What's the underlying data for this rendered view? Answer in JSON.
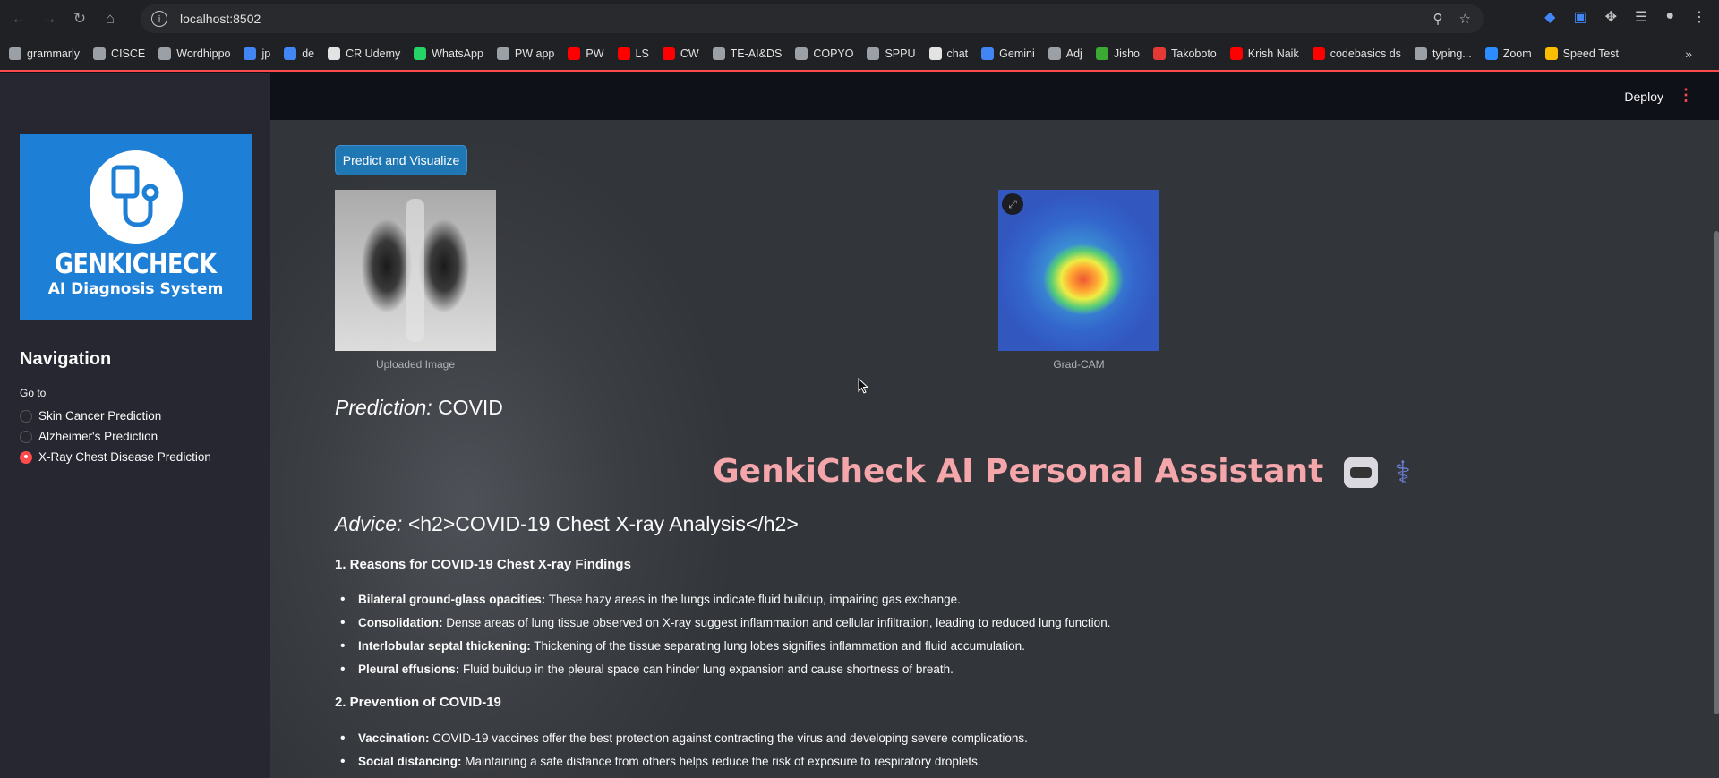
{
  "browser": {
    "url": "localhost:8502",
    "bookmarks": [
      {
        "label": "grammarly",
        "color": "#9aa0a6"
      },
      {
        "label": "CISCE",
        "color": "#9aa0a6"
      },
      {
        "label": "Wordhippo",
        "color": "#9aa0a6"
      },
      {
        "label": "jp",
        "color": "#4285f4"
      },
      {
        "label": "de",
        "color": "#4285f4"
      },
      {
        "label": "CR Udemy",
        "color": "#e3e3e3"
      },
      {
        "label": "WhatsApp",
        "color": "#25d366"
      },
      {
        "label": "PW app",
        "color": "#9aa0a6"
      },
      {
        "label": "PW",
        "color": "#ff0000"
      },
      {
        "label": "LS",
        "color": "#ff0000"
      },
      {
        "label": "CW",
        "color": "#ff0000"
      },
      {
        "label": "TE-AI&DS",
        "color": "#9aa0a6"
      },
      {
        "label": "COPYO",
        "color": "#9aa0a6"
      },
      {
        "label": "SPPU",
        "color": "#9aa0a6"
      },
      {
        "label": "chat",
        "color": "#e3e3e3"
      },
      {
        "label": "Gemini",
        "color": "#4285f4"
      },
      {
        "label": "Adj",
        "color": "#9aa0a6"
      },
      {
        "label": "Jisho",
        "color": "#3aaa35"
      },
      {
        "label": "Takoboto",
        "color": "#e53935"
      },
      {
        "label": "Krish Naik",
        "color": "#ff0000"
      },
      {
        "label": "codebasics ds",
        "color": "#ff0000"
      },
      {
        "label": "typing...",
        "color": "#9aa0a6"
      },
      {
        "label": "Zoom",
        "color": "#2d8cff"
      },
      {
        "label": "Speed Test",
        "color": "#fbbc04"
      }
    ]
  },
  "sidebar": {
    "logo_title": "GENKICHECK",
    "logo_subtitle": "AI Diagnosis System",
    "nav_title": "Navigation",
    "goto_label": "Go to",
    "options": [
      {
        "label": "Skin Cancer Prediction",
        "selected": false
      },
      {
        "label": "Alzheimer's Prediction",
        "selected": false
      },
      {
        "label": "X-Ray Chest Disease Prediction",
        "selected": true
      }
    ]
  },
  "header": {
    "deploy_label": "Deploy"
  },
  "main": {
    "predict_button": "Predict and Visualize",
    "uploaded_caption": "Uploaded Image",
    "gradcam_caption": "Grad-CAM",
    "prediction_label": "Prediction:",
    "prediction_value": "COVID",
    "assistant_title": "GenkiCheck AI Personal Assistant",
    "advice_label": "Advice:",
    "advice_heading": "<h2>COVID-19 Chest X-ray Analysis</h2>",
    "section1_title": "1. Reasons for COVID-19 Chest X-ray Findings",
    "section1_items": [
      {
        "term": "Bilateral ground-glass opacities:",
        "text": "These hazy areas in the lungs indicate fluid buildup, impairing gas exchange."
      },
      {
        "term": "Consolidation:",
        "text": "Dense areas of lung tissue observed on X-ray suggest inflammation and cellular infiltration, leading to reduced lung function."
      },
      {
        "term": "Interlobular septal thickening:",
        "text": "Thickening of the tissue separating lung lobes signifies inflammation and fluid accumulation."
      },
      {
        "term": "Pleural effusions:",
        "text": "Fluid buildup in the pleural space can hinder lung expansion and cause shortness of breath."
      }
    ],
    "section2_title": "2. Prevention of COVID-19",
    "section2_items": [
      {
        "term": "Vaccination:",
        "text": "COVID-19 vaccines offer the best protection against contracting the virus and developing severe complications."
      },
      {
        "term": "Social distancing:",
        "text": "Maintaining a safe distance from others helps reduce the risk of exposure to respiratory droplets."
      }
    ]
  },
  "colors": {
    "accent": "#ff4b4b",
    "button": "#1f77b4",
    "assistant_title": "#f4a6ab",
    "logo_bg": "#1e7fd6"
  }
}
